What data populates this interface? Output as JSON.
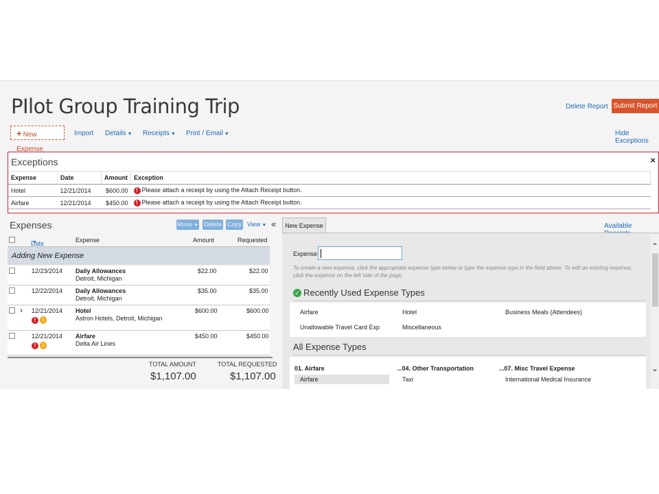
{
  "header": {
    "title": "PIlot Group Training Trip",
    "delete_report": "Delete Report",
    "submit_report": "Submit Report",
    "new_expense": "New Expense",
    "toolbar": [
      "Import",
      "Details",
      "Receipts",
      "Print / Email"
    ],
    "hide_exceptions": "Hide Exceptions"
  },
  "exceptions": {
    "title": "Exceptions",
    "close": "×",
    "columns": [
      "Expense",
      "Date",
      "Amount",
      "Exception"
    ],
    "rows": [
      {
        "expense": "Hotel",
        "date": "12/21/2014",
        "amount": "$600.00",
        "exception": "Please attach a receipt by using the Attach Receipt button."
      },
      {
        "expense": "Airfare",
        "date": "12/21/2014",
        "amount": "$450.00",
        "exception": "Please attach a receipt by using the Attach Receipt button."
      }
    ]
  },
  "expenses": {
    "title": "Expenses",
    "move": "Move",
    "delete": "Delete",
    "copy": "Copy",
    "view": "View",
    "collapse": "«",
    "columns": {
      "date": "Date",
      "expense": "Expense",
      "amount": "Amount",
      "requested": "Requested"
    },
    "adding": "Adding New Expense",
    "rows": [
      {
        "date": "12/23/2014",
        "name": "Daily Allowances",
        "detail": "Detroit, Michigan",
        "amount": "$22.00",
        "requested": "$22.00"
      },
      {
        "date": "12/22/2014",
        "name": "Daily Allowances",
        "detail": "Detroit, Michigan",
        "amount": "$35.00",
        "requested": "$35.00"
      },
      {
        "date": "12/21/2014",
        "name": "Hotel",
        "detail": "Astron Hotels, Detroit, Michigan",
        "amount": "$600.00",
        "requested": "$600.00"
      },
      {
        "date": "12/21/2014",
        "name": "Airfare",
        "detail": "Delta Air Lines",
        "amount": "$450.00",
        "requested": "$450.00"
      }
    ],
    "total_amount_label": "TOTAL AMOUNT",
    "total_amount": "$1,107.00",
    "total_requested_label": "TOTAL REQUESTED",
    "total_requested": "$1,107.00"
  },
  "new_expense_panel": {
    "tab": "New Expense",
    "available_receipts": "Available Receipts",
    "expense_label": "Expense",
    "hint": "To create a new expense, click the appropriate expense type below or type the expense type in the field above. To edit an existing expense, click the expense on the left side of the page.",
    "recent_title": "Recently Used Expense Types",
    "recent": [
      "Airfare",
      "Hotel",
      "Business Meals (Attendees)",
      "Unallowable Travel Card Exp",
      "Miscellaneous"
    ],
    "all_title": "All Expense Types",
    "all_headers": [
      "01. Airfare",
      "...04. Other Transportation",
      "...07. Misc Travel Expense"
    ],
    "all_items": [
      "Airfare",
      "Taxi",
      "International Medical Insurance"
    ]
  },
  "colors": {
    "accent": "#d9532b",
    "link": "#1e6bb8",
    "error": "#d0202a",
    "success": "#3aa64a"
  }
}
